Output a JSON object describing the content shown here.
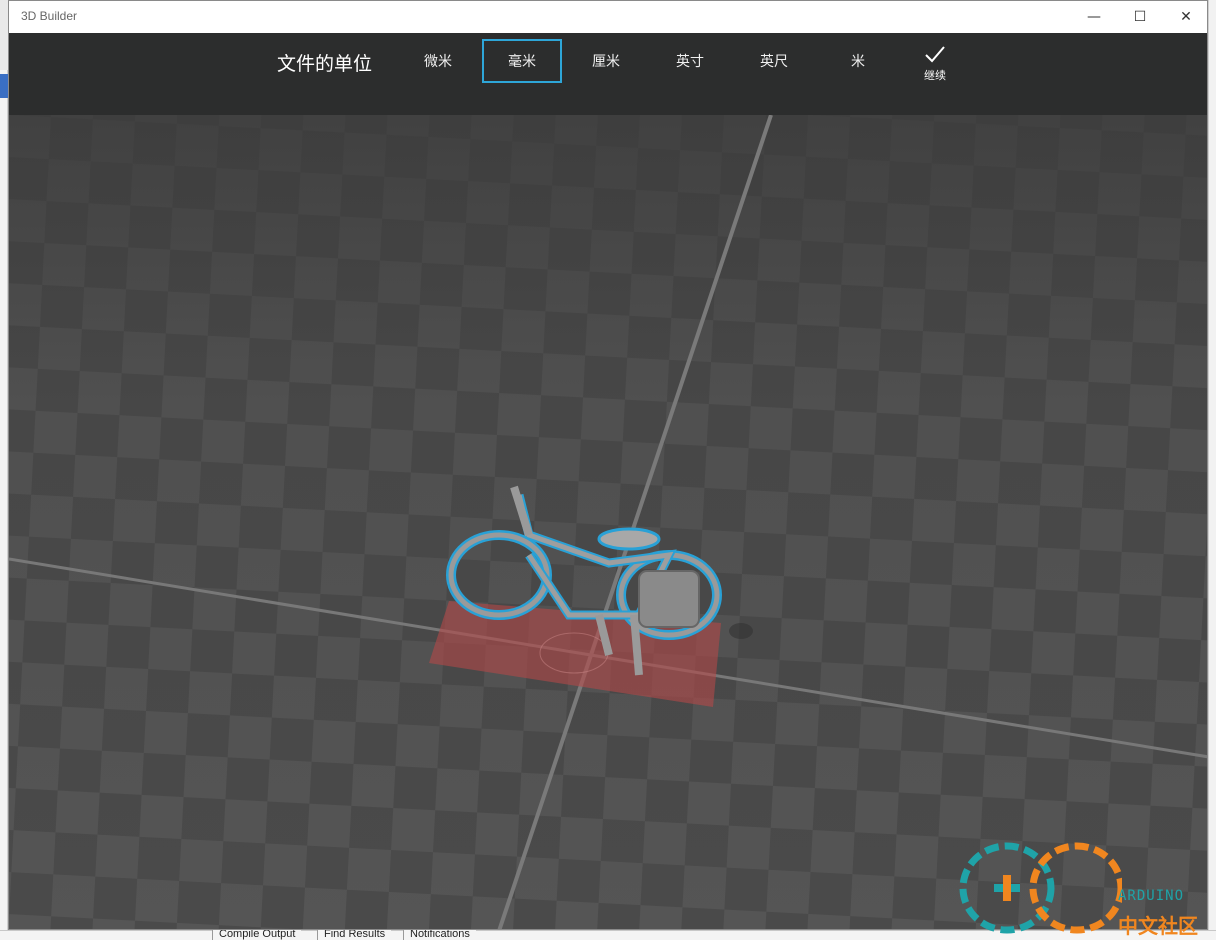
{
  "window": {
    "title": "3D Builder",
    "controls": {
      "minimize": "—",
      "maximize": "☐",
      "close": "✕"
    }
  },
  "toolbar": {
    "heading": "文件的单位",
    "units": [
      {
        "label": "微米",
        "selected": false
      },
      {
        "label": "毫米",
        "selected": true
      },
      {
        "label": "厘米",
        "selected": false
      },
      {
        "label": "英寸",
        "selected": false
      },
      {
        "label": "英尺",
        "selected": false
      },
      {
        "label": "米",
        "selected": false
      }
    ],
    "continue_label": "继续",
    "accent_color": "#2ea6d8"
  },
  "background_ide": {
    "bottom_tabs": [
      "Compile Output",
      "Find Results",
      "Notifications"
    ]
  },
  "watermark": {
    "brand": "ARDUINO",
    "subtitle": "中文社区"
  },
  "icons": {
    "continue": "checkmark-icon"
  }
}
